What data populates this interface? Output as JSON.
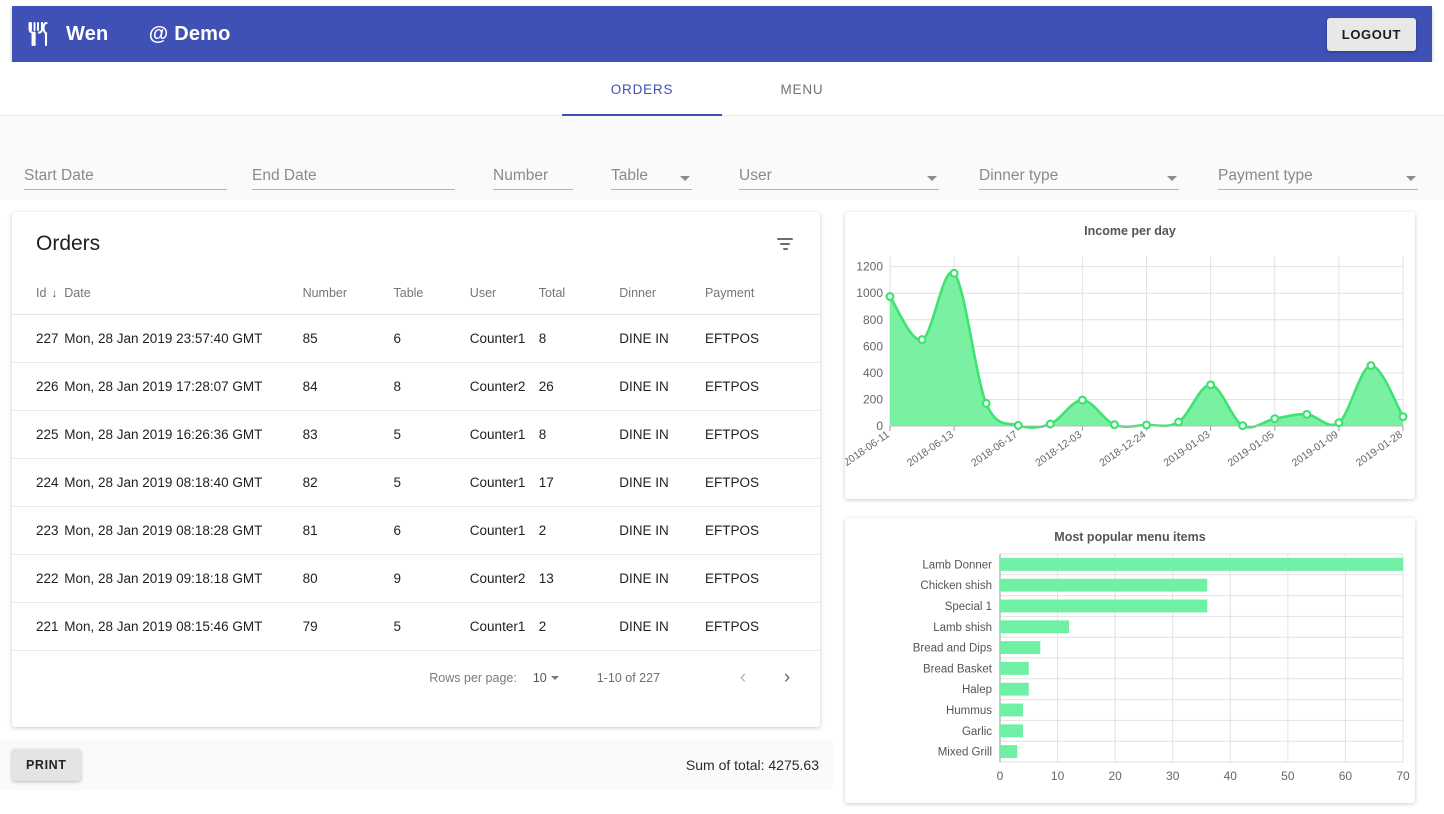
{
  "appbar": {
    "brand_icon": "restaurant-cutlery-icon",
    "title": "Wen       @ Demo",
    "logout_label": "LOGOUT",
    "bg_color": "#3f51b5"
  },
  "tabs": [
    {
      "label": "ORDERS",
      "active": true
    },
    {
      "label": "MENU",
      "active": false
    }
  ],
  "filters": [
    {
      "name": "start-date",
      "label": "Start Date",
      "value": "",
      "type": "text"
    },
    {
      "name": "end-date",
      "label": "End Date",
      "value": "",
      "type": "text"
    },
    {
      "name": "number",
      "label": "Number",
      "value": "",
      "type": "text"
    },
    {
      "name": "table",
      "label": "Table",
      "value": "",
      "type": "select"
    },
    {
      "name": "user",
      "label": "User",
      "value": "",
      "type": "select"
    },
    {
      "name": "dinner-type",
      "label": "Dinner type",
      "value": "",
      "type": "select"
    },
    {
      "name": "payment-type",
      "label": "Payment type",
      "value": "",
      "type": "select"
    }
  ],
  "orders": {
    "title": "Orders",
    "filter_icon": "filter-list-icon",
    "columns": [
      "Id",
      "Date",
      "Number",
      "Table",
      "User",
      "Total",
      "Dinner",
      "Payment"
    ],
    "sort_column": "Id",
    "sort_direction": "desc",
    "sort_arrow_glyph": "↓",
    "rows": [
      {
        "id": "227",
        "date": "Mon, 28 Jan 2019 23:57:40 GMT",
        "number": "85",
        "table": "6",
        "user": "Counter1",
        "total": "8",
        "dinner": "DINE IN",
        "payment": "EFTPOS"
      },
      {
        "id": "226",
        "date": "Mon, 28 Jan 2019 17:28:07 GMT",
        "number": "84",
        "table": "8",
        "user": "Counter2",
        "total": "26",
        "dinner": "DINE IN",
        "payment": "EFTPOS"
      },
      {
        "id": "225",
        "date": "Mon, 28 Jan 2019 16:26:36 GMT",
        "number": "83",
        "table": "5",
        "user": "Counter1",
        "total": "8",
        "dinner": "DINE IN",
        "payment": "EFTPOS"
      },
      {
        "id": "224",
        "date": "Mon, 28 Jan 2019 08:18:40 GMT",
        "number": "82",
        "table": "5",
        "user": "Counter1",
        "total": "17",
        "dinner": "DINE IN",
        "payment": "EFTPOS"
      },
      {
        "id": "223",
        "date": "Mon, 28 Jan 2019 08:18:28 GMT",
        "number": "81",
        "table": "6",
        "user": "Counter1",
        "total": "2",
        "dinner": "DINE IN",
        "payment": "EFTPOS"
      },
      {
        "id": "222",
        "date": "Mon, 28 Jan 2019 09:18:18 GMT",
        "number": "80",
        "table": "9",
        "user": "Counter2",
        "total": "13",
        "dinner": "DINE IN",
        "payment": "EFTPOS"
      },
      {
        "id": "221",
        "date": "Mon, 28 Jan 2019 08:15:46 GMT",
        "number": "79",
        "table": "5",
        "user": "Counter1",
        "total": "2",
        "dinner": "DINE IN",
        "payment": "EFTPOS"
      }
    ],
    "pagination": {
      "rows_per_page_label": "Rows per page:",
      "rows_per_page_value": "10",
      "range_label": "1-10 of 227",
      "prev_glyph": "‹",
      "next_glyph": "›"
    }
  },
  "footer": {
    "print_label": "PRINT",
    "sum_label": "Sum of total: 4275.63"
  },
  "chart_data": [
    {
      "type": "area",
      "name": "income-per-day-chart",
      "title": "Income per day",
      "xlabel": "",
      "ylabel": "",
      "ylim": [
        0,
        1280
      ],
      "yticks": [
        0,
        200,
        400,
        600,
        800,
        1000,
        1200
      ],
      "grid": true,
      "legend": "none",
      "line_color": "#3ee372",
      "fill_color": "#6ff09a",
      "x": [
        "2018-06-11",
        "2018-06-13",
        "2018-06-17",
        "2018-12-03",
        "2018-12-24",
        "2019-01-03",
        "2019-01-05",
        "2019-01-09",
        "2019-01-28"
      ],
      "tick_labels": [
        "2018-06-11",
        "2018-06-13",
        "2018-06-17",
        "2018-12-03",
        "2018-12-24",
        "2019-01-03",
        "2019-01-05",
        "2019-01-09",
        "2019-01-28"
      ],
      "values": [
        975,
        650,
        1150,
        170,
        5,
        15,
        195,
        10,
        8,
        30,
        310,
        2,
        55,
        88,
        25,
        455,
        70
      ]
    },
    {
      "type": "bar",
      "orientation": "horizontal",
      "name": "most-popular-menu-items-chart",
      "title": "Most popular menu items",
      "xlabel": "",
      "ylabel": "",
      "xlim": [
        0,
        70
      ],
      "xticks": [
        0,
        10,
        20,
        30,
        40,
        50,
        60,
        70
      ],
      "grid": true,
      "legend": "none",
      "bar_color": "#6ff0a5",
      "categories": [
        "Lamb Donner",
        "Chicken shish",
        "Special 1",
        "Lamb shish",
        "Bread and Dips",
        "Bread Basket",
        "Halep",
        "Hummus",
        "Garlic",
        "Mixed Grill"
      ],
      "values": [
        70,
        36,
        36,
        12,
        7,
        5,
        5,
        4,
        4,
        3
      ]
    }
  ]
}
